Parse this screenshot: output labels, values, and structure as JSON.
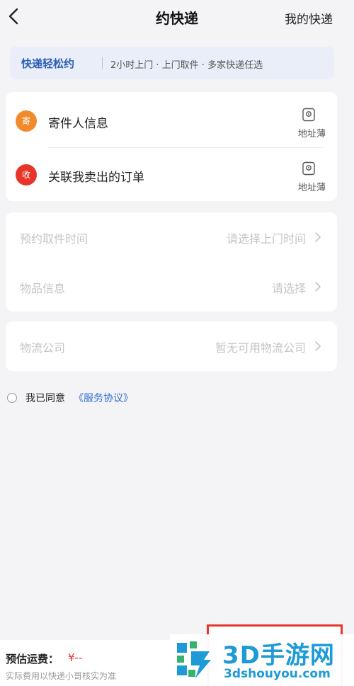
{
  "header": {
    "title": "约快递",
    "right_link": "我的快递",
    "back_icon": "chevron-left-icon"
  },
  "banner": {
    "title": "快递轻松约",
    "description": "2小时上门 · 上门取件 · 多家快递任选"
  },
  "contact_card": {
    "rows": [
      {
        "badge": "寄",
        "badge_color": "#f28a2c",
        "label": "寄件人信息",
        "action_icon": "address-book-icon",
        "action_label": "地址薄"
      },
      {
        "badge": "收",
        "badge_color": "#e8352a",
        "label": "关联我卖出的订单",
        "action_icon": "address-book-icon",
        "action_label": "地址薄"
      }
    ]
  },
  "pickup_card": {
    "fields": [
      {
        "label": "预约取件时间",
        "value": "请选择上门时间"
      },
      {
        "label": "物品信息",
        "value": "请选择"
      }
    ]
  },
  "logistics_card": {
    "label": "物流公司",
    "value": "暂无可用物流公司"
  },
  "agreement": {
    "text": "我已同意",
    "link": "《服务协议》",
    "checked": false
  },
  "footer": {
    "estimate_label": "预估运费：",
    "estimate_value": "¥--",
    "note": "实际费用以快递小哥核实为准"
  },
  "watermark": {
    "title": "3D手游网",
    "url": "3dshouyou.com"
  },
  "colors": {
    "accent_blue": "#2c5fb6",
    "link_blue": "#2f6fd0",
    "price_red": "#e8352a",
    "sender_orange": "#f28a2c",
    "highlight_border": "#e8352a"
  }
}
